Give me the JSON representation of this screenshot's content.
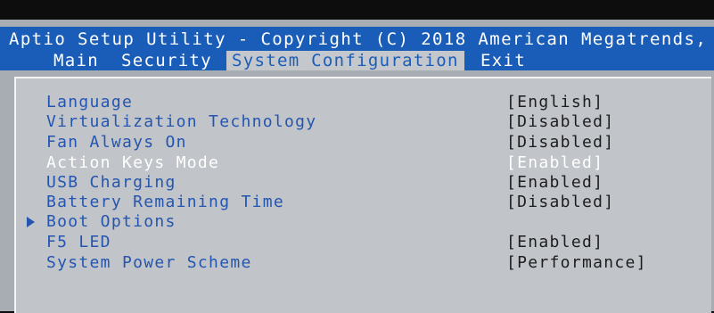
{
  "header": {
    "title": "Aptio Setup Utility - Copyright (C) 2018 American Megatrends,"
  },
  "tabs": [
    {
      "label": "Main"
    },
    {
      "label": "Security"
    },
    {
      "label": "System Configuration"
    },
    {
      "label": "Exit"
    }
  ],
  "selected_tab": "System Configuration",
  "settings": [
    {
      "label": "Language",
      "value": "[English]"
    },
    {
      "label": "Virtualization Technology",
      "value": "[Disabled]"
    },
    {
      "label": "Fan Always On",
      "value": "[Disabled]"
    },
    {
      "label": "Action Keys Mode",
      "value": "[Enabled]"
    },
    {
      "label": "USB Charging",
      "value": "[Enabled]"
    },
    {
      "label": "Battery Remaining Time",
      "value": "[Disabled]"
    },
    {
      "label": "Boot Options",
      "value": ""
    },
    {
      "label": "F5 LED",
      "value": "[Enabled]"
    },
    {
      "label": "System Power Scheme",
      "value": "[Performance]"
    }
  ],
  "colors": {
    "header_blue": "#1a5db8",
    "label_blue": "#2455b0",
    "panel_gray": "#c1c4c9",
    "highlight_text": "#ffffff"
  },
  "icons": {
    "submenu": "triangle-right-icon"
  }
}
